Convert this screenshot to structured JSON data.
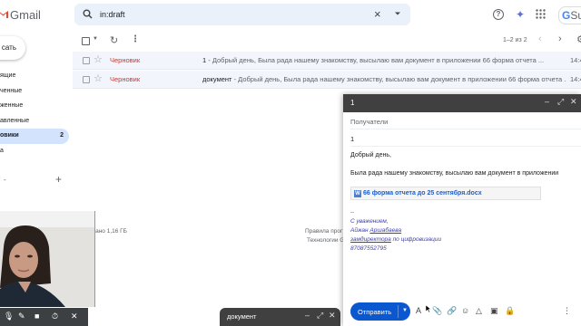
{
  "header": {
    "app_name": "Gmail",
    "search_value": "in:draft",
    "brand_g": "G",
    "brand_s": "Su"
  },
  "sidebar": {
    "compose_label": "сать",
    "items": [
      {
        "label": "ящие",
        "active": false
      },
      {
        "label": "ченные",
        "active": false
      },
      {
        "label": "женные",
        "active": false
      },
      {
        "label": "авленные",
        "active": false
      },
      {
        "label": "овики",
        "active": true,
        "count": "2"
      },
      {
        "label": "а",
        "active": false
      }
    ],
    "labels_dash": "-",
    "labels_plus": "+"
  },
  "toolbar": {
    "pager": "1–2 из 2"
  },
  "mails": [
    {
      "sender": "Черновик",
      "subject": "1",
      "snippet": " - Добрый день, Была рада нашему знакомству, высылаю вам документ в приложении 66 форма отчета ...",
      "date": "14:4"
    },
    {
      "sender": "Черновик",
      "subject": "документ",
      "snippet": " - Добрый день, Была рада нашему знакомству, высылаю вам документ в приложении 66 форма отчета ...",
      "date": "14:4"
    }
  ],
  "footer": {
    "storage": "льзовано 1,16 ГБ",
    "policy1": "Правила прог",
    "policy2": "Технологии G"
  },
  "minimized_draft": {
    "title": "документ"
  },
  "compose": {
    "title": "1",
    "to_label": "Получатели",
    "subject": "1",
    "greeting": "Добрый день,",
    "body": "Была рада нашему знакомству, высылаю вам документ в приложении",
    "attachment": "66 форма отчета до 25 сентября.docx",
    "attachment_icon": "W",
    "sig_dash": "--",
    "sig_regards": "С уважением,",
    "sig_name_first": "Айжан ",
    "sig_name_last": "Аршабаева",
    "sig_title_a": "замдиректора",
    "sig_title_b": " по цифровизации",
    "sig_phone": "87087552795",
    "send_label": "Отправить"
  }
}
